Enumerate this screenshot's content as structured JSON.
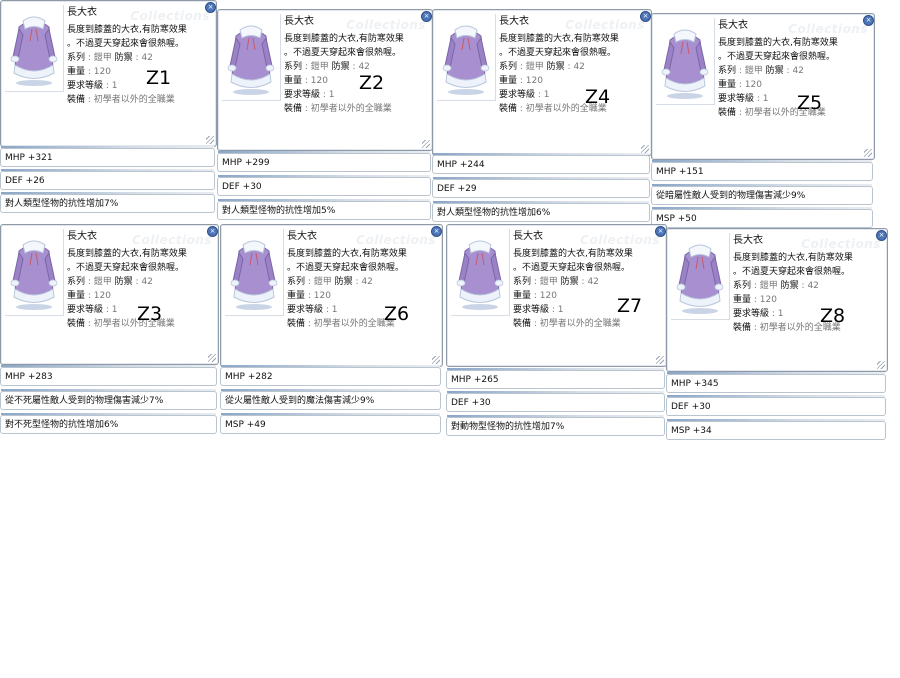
{
  "item": {
    "name": "長大衣",
    "watermark": "Collections",
    "desc1": "長度到膝蓋的大衣,有防寒效果",
    "desc2": "。不過夏天穿起來會很熱喔。",
    "series_label": "系列",
    "series_value": "鎧甲",
    "def_label": "防禦",
    "def_value": "42",
    "weight_label": "重量",
    "weight_value": "120",
    "level_label": "要求等級",
    "level_value": "1",
    "equip_label": "裝備",
    "equip_value": "初學者以外的全職業",
    "close_icon": "close-icon",
    "item_image": "purple-coat-icon"
  },
  "cards": [
    {
      "label": "Z1",
      "stats": [
        "MHP +321",
        "DEF +26",
        "對人類型怪物的抗性增加7%"
      ]
    },
    {
      "label": "Z2",
      "stats": [
        "MHP +299",
        "DEF +30",
        "對人類型怪物的抗性增加5%"
      ]
    },
    {
      "label": "Z4",
      "stats": [
        "MHP +244",
        "DEF +29",
        "對人類型怪物的抗性增加6%"
      ]
    },
    {
      "label": "Z5",
      "stats": [
        "MHP +151",
        "從暗屬性敵人受到的物理傷害減少9%",
        "MSP +50"
      ]
    },
    {
      "label": "Z3",
      "stats": [
        "MHP +283",
        "從不死屬性敵人受到的物理傷害減少7%",
        "對不死型怪物的抗性增加6%"
      ]
    },
    {
      "label": "Z6",
      "stats": [
        "MHP +282",
        "從火屬性敵人受到的魔法傷害減少9%",
        "MSP +49"
      ]
    },
    {
      "label": "Z7",
      "stats": [
        "MHP +265",
        "DEF +30",
        "對動物型怪物的抗性增加7%"
      ]
    },
    {
      "label": "Z8",
      "stats": [
        "MHP +345",
        "DEF +30",
        "MSP +34"
      ]
    }
  ]
}
